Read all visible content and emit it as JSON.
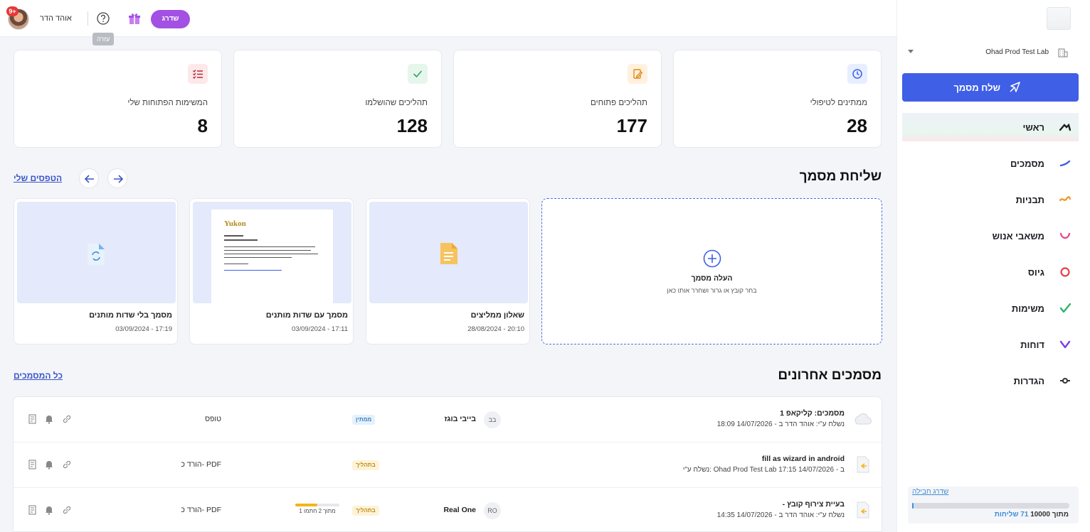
{
  "topbar": {
    "user_name": "אוהד הדר",
    "notifications_badge": "9+",
    "help_tooltip": "עזרה",
    "upgrade_label": "שדרג"
  },
  "sidebar": {
    "org_name": "Ohad Prod Test Lab",
    "send_button": "שלח מסמך",
    "nav": [
      {
        "label": "ראשי",
        "icon": "home-icon",
        "color": "#1d1f24",
        "active": true
      },
      {
        "label": "מסמכים",
        "icon": "documents-icon",
        "color": "#3f5fe6"
      },
      {
        "label": "תבניות",
        "icon": "templates-icon",
        "color": "#f09a2e"
      },
      {
        "label": "משאבי אנוש",
        "icon": "hr-icon",
        "color": "#e24f8b"
      },
      {
        "label": "גיוס",
        "icon": "recruit-icon",
        "color": "#e0404a"
      },
      {
        "label": "משימות",
        "icon": "tasks-icon",
        "color": "#2fb36a"
      },
      {
        "label": "דוחות",
        "icon": "reports-icon",
        "color": "#7b3fe0"
      },
      {
        "label": "הגדרות",
        "icon": "settings-icon",
        "color": "#333333"
      }
    ],
    "plan": {
      "upgrade_link": "שדרג חבילה",
      "sent_label": "71 שליחות",
      "of_label": "מתוך 10000",
      "usage_fraction": 0.0071
    }
  },
  "stats": [
    {
      "label": "ממתינים לטיפולי",
      "value": "28",
      "icon": "clock-icon",
      "icon_bg": "#e7eeff",
      "icon_color": "#3f5fe6"
    },
    {
      "label": "תהליכים פתוחים",
      "value": "177",
      "icon": "edit-doc-icon",
      "icon_bg": "#fff1de",
      "icon_color": "#e08a17"
    },
    {
      "label": "תהליכים שהושלמו",
      "value": "128",
      "icon": "check-icon",
      "icon_bg": "#e6f6ec",
      "icon_color": "#2fa35f"
    },
    {
      "label": "המשימות הפתוחות שלי",
      "value": "8",
      "icon": "checklist-icon",
      "icon_bg": "#fde8ea",
      "icon_color": "#b52a35"
    }
  ],
  "send_section": {
    "title": "שליחת מסמך",
    "my_forms_link": "הטפסים שלי",
    "upload_title": "העלה מסמך",
    "upload_sub": "בחר קובץ או גרור ושחרר אותו כאן",
    "templates": [
      {
        "name": "שאלון ממליצים",
        "date": "28/08/2024 - 20:10",
        "thumb": "file-icon"
      },
      {
        "name": "מסמך עם שדות מותנים",
        "date": "03/09/2024 - 17:11",
        "thumb": "document-preview",
        "preview_brand": "Yukon"
      },
      {
        "name": "מסמך בלי שדות מותנים",
        "date": "03/09/2024 - 17:19",
        "thumb": "sync-file-icon"
      }
    ]
  },
  "recent_section": {
    "title": "מסמכים אחרונים",
    "all_docs_link": "כל המסמכים",
    "rows": [
      {
        "title": "1 מסמכים: קליקאפ",
        "sub": "נשלח ע\"י: אוהד הדר ב - 14/07/2026 18:09",
        "avatar": "בב",
        "person": "בייבי בוגז",
        "status": "ממתין",
        "status_kind": "waiting",
        "action": "טופס"
      },
      {
        "title": "fill as wizard in android",
        "sub": "נשלח ע\"י: Ohad Prod Test Lab ב - 14/07/2026 17:15",
        "avatar": "",
        "person": "",
        "status": "בתהליך",
        "status_kind": "inprocess",
        "action": "הורד כ- PDF"
      },
      {
        "title": "- בעיית צירוף קובץ",
        "sub": "נשלח ע\"י: אוהד הדר ב - 14/07/2026 14:35",
        "avatar": "RO",
        "person": "Real One",
        "status": "בתהליך",
        "status_kind": "inprocess",
        "progress_label": "1 מתוך 2 חתמו",
        "progress_fraction": 0.5,
        "action": "הורד כ- PDF"
      }
    ]
  }
}
